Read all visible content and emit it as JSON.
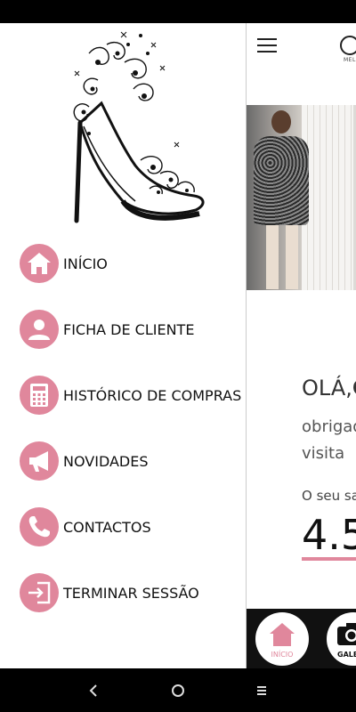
{
  "drawer": {
    "items": [
      {
        "label": "INÍCIO",
        "icon": "home-icon"
      },
      {
        "label": "FICHA DE CLIENTE",
        "icon": "user-icon"
      },
      {
        "label": "HISTÓRICO DE COMPRAS",
        "icon": "calculator-icon"
      },
      {
        "label": "NOVIDADES",
        "icon": "megaphone-icon"
      },
      {
        "label": "CONTACTOS",
        "icon": "phone-icon"
      },
      {
        "label": "TERMINAR SESSÃO",
        "icon": "logout-icon"
      }
    ],
    "accent_color": "#e0879c"
  },
  "app": {
    "logo_sub": "MEL",
    "greeting_prefix": "OLÁ,",
    "greeting_name": "C",
    "thanks_line1": "obrigad",
    "thanks_line2": "visita",
    "balance_label": "O seu sa",
    "balance_value": "4.5",
    "bottom_nav": {
      "inicio_label": "INÍCIO",
      "galeria_label": "GALE"
    }
  },
  "system_nav": {
    "back_icon": "back-icon",
    "home_icon": "home-circle-icon",
    "recents_icon": "recents-icon"
  }
}
